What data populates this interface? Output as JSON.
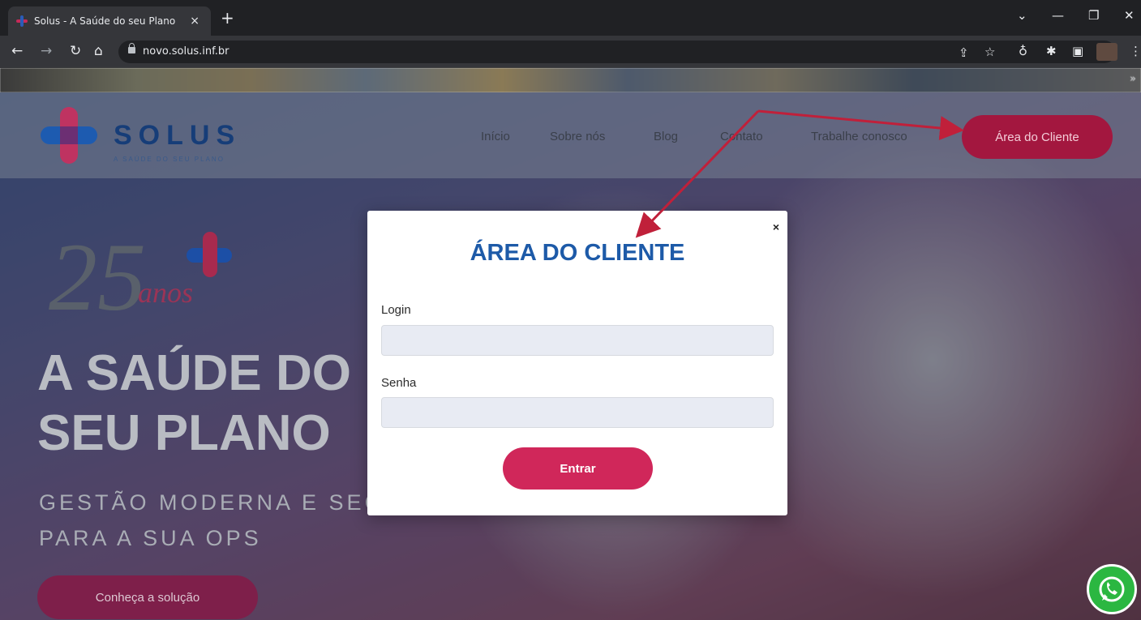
{
  "browser": {
    "tab_title": "Solus - A Saúde do seu Plano",
    "tab_close": "×",
    "new_tab": "+",
    "url": "novo.solus.inf.br",
    "bookmarks_more": "»",
    "window_controls": {
      "dropdown": "⌄",
      "minimize": "—",
      "restore": "❐",
      "close": "✕"
    },
    "toolbar_icons": [
      "share-icon",
      "star-icon",
      "extension-icon",
      "puzzle-icon",
      "sidepanel-icon",
      "menu-icon"
    ]
  },
  "site": {
    "logo": {
      "name": "SOLUS",
      "tagline": "A SAÚDE DO SEU PLANO"
    },
    "nav": [
      {
        "label": "Início"
      },
      {
        "label": "Sobre nós"
      },
      {
        "label": "Blog"
      },
      {
        "label": "Contato"
      },
      {
        "label": "Trabalhe conosco"
      }
    ],
    "client_area_button": "Área do Cliente",
    "badge": {
      "number": "25",
      "word": "anos"
    },
    "hero": {
      "title_line1": "A SAÚDE DO",
      "title_line2": "SEU PLANO",
      "subtitle_line1": "GESTÃO MODERNA E SEGURA",
      "subtitle_line2": "PARA A SUA OPS",
      "cta": "Conheça a solução"
    },
    "colors": {
      "brand_blue": "#1d5aa8",
      "brand_red": "#d0275a",
      "whatsapp": "#2bb741"
    }
  },
  "modal": {
    "close_label": "×",
    "title": "ÁREA DO CLIENTE",
    "login_label": "Login",
    "login_value": "",
    "password_label": "Senha",
    "password_value": "",
    "submit_label": "Entrar"
  }
}
